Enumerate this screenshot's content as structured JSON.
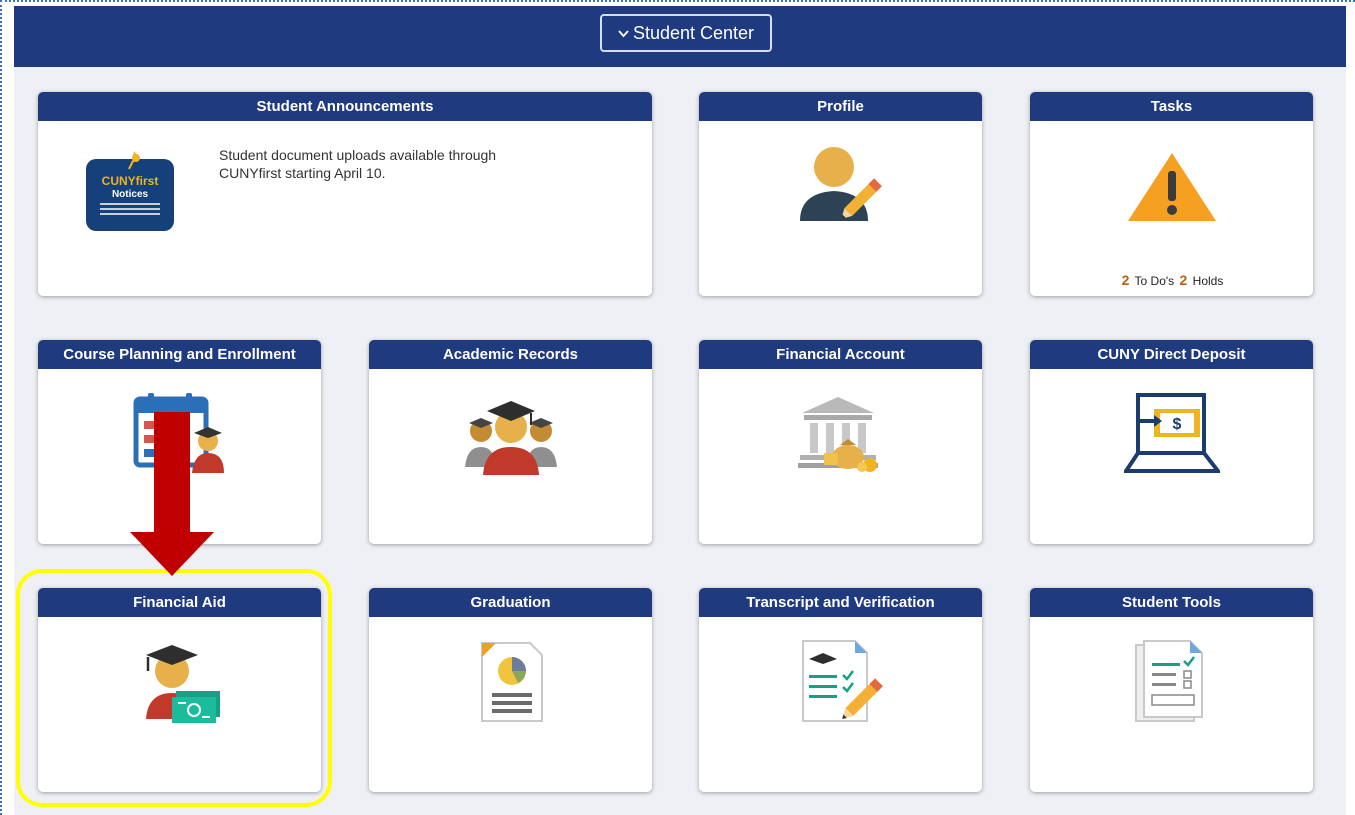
{
  "header": {
    "title": "Student Center"
  },
  "tiles": {
    "announcements": {
      "title": "Student Announcements",
      "text": "Student document uploads available through CUNYfirst starting April 10.",
      "badge_line1": "CUNYfirst",
      "badge_line2": "Notices"
    },
    "profile": {
      "title": "Profile"
    },
    "tasks": {
      "title": "Tasks",
      "todos_count": "2",
      "todos_label": "To Do's",
      "holds_count": "2",
      "holds_label": "Holds"
    },
    "course_planning": {
      "title": "Course Planning and Enrollment"
    },
    "academic_records": {
      "title": "Academic Records"
    },
    "financial_account": {
      "title": "Financial Account"
    },
    "direct_deposit": {
      "title": "CUNY Direct Deposit"
    },
    "financial_aid": {
      "title": "Financial Aid"
    },
    "graduation": {
      "title": "Graduation"
    },
    "transcript": {
      "title": "Transcript and Verification"
    },
    "student_tools": {
      "title": "Student Tools"
    }
  },
  "icons": {
    "announcements": "cunyfirst-notices-icon",
    "profile": "profile-edit-icon",
    "tasks": "warning-icon",
    "course_planning": "calendar-student-icon",
    "academic_records": "graduates-icon",
    "financial_account": "bank-icon",
    "direct_deposit": "laptop-payment-icon",
    "financial_aid": "graduate-money-icon",
    "graduation": "report-chart-icon",
    "transcript": "transcript-checklist-icon",
    "student_tools": "document-checklist-icon"
  },
  "colors": {
    "brand_navy": "#1f3a7f",
    "page_background": "#eef0f6",
    "count_orange": "#b56316",
    "highlight_yellow": "#ffff00",
    "arrow_red": "#c00000"
  }
}
